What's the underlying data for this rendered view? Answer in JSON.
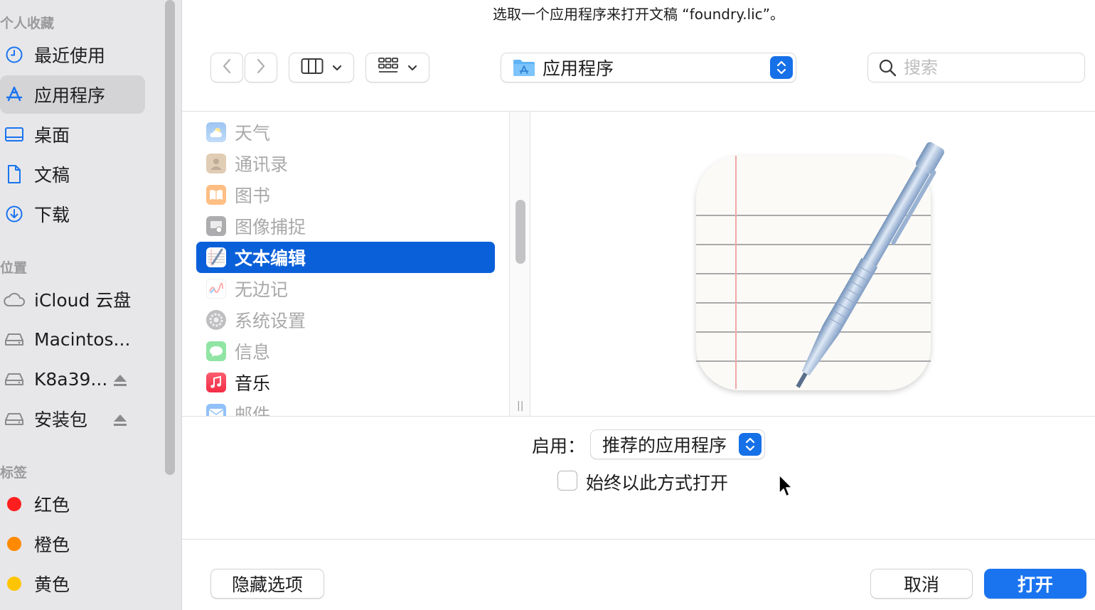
{
  "dialog": {
    "title": "选取一个应用程序来打开文稿 “foundry.lic”。"
  },
  "sidebar": {
    "favorites_header": "个人收藏",
    "favorites": [
      {
        "label": "最近使用",
        "icon": "clock-icon"
      },
      {
        "label": "应用程序",
        "icon": "apps-icon",
        "active": true
      },
      {
        "label": "桌面",
        "icon": "desktop-icon"
      },
      {
        "label": "文稿",
        "icon": "document-icon"
      },
      {
        "label": "下载",
        "icon": "download-icon"
      }
    ],
    "locations_header": "位置",
    "locations": [
      {
        "label": "iCloud 云盘",
        "icon": "cloud-icon"
      },
      {
        "label": "Macintos...",
        "icon": "disk-icon"
      },
      {
        "label": "K8a39...",
        "icon": "disk-icon",
        "eject": true
      },
      {
        "label": "安装包",
        "icon": "disk-icon",
        "eject": true
      }
    ],
    "tags_header": "标签",
    "tags": [
      {
        "label": "红色",
        "color": "#ff1f1f"
      },
      {
        "label": "橙色",
        "color": "#ff8a00"
      },
      {
        "label": "黄色",
        "color": "#ffc400"
      }
    ]
  },
  "toolbar": {
    "location": "应用程序",
    "search_placeholder": "搜索"
  },
  "app_list": [
    {
      "label": "天气",
      "icon": "weather-icon",
      "enabled": false
    },
    {
      "label": "通讯录",
      "icon": "contacts-icon",
      "enabled": false
    },
    {
      "label": "图书",
      "icon": "books-icon",
      "enabled": false
    },
    {
      "label": "图像捕捉",
      "icon": "image-capture-icon",
      "enabled": false
    },
    {
      "label": "文本编辑",
      "icon": "textedit-icon",
      "enabled": true,
      "selected": true
    },
    {
      "label": "无边记",
      "icon": "freeform-icon",
      "enabled": false
    },
    {
      "label": "系统设置",
      "icon": "settings-icon",
      "enabled": false
    },
    {
      "label": "信息",
      "icon": "messages-icon",
      "enabled": false
    },
    {
      "label": "音乐",
      "icon": "music-icon",
      "enabled": true
    },
    {
      "label": "邮件",
      "icon": "mail-icon",
      "enabled": false
    }
  ],
  "options": {
    "enable_label": "启用：",
    "enable_value": "推荐的应用程序",
    "always_open_label": "始终以此方式打开",
    "always_open_checked": false
  },
  "buttons": {
    "hide_options": "隐藏选项",
    "cancel": "取消",
    "open": "打开"
  },
  "colors": {
    "accent": "#1a74f0",
    "selection": "#0a60d9"
  }
}
